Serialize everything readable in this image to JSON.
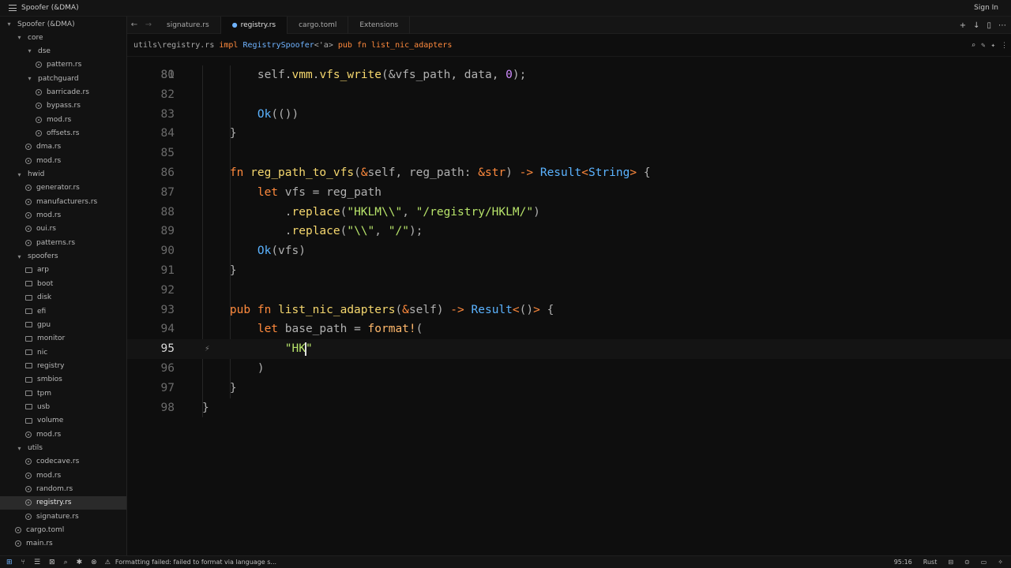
{
  "titlebar": {
    "app_title": "Spoofer (&DMA)",
    "signin": "Sign In"
  },
  "sidebar": {
    "root": "Spoofer (&DMA)",
    "items": [
      {
        "label": "core",
        "kind": "folder",
        "depth": 1,
        "expanded": true
      },
      {
        "label": "dse",
        "kind": "folder",
        "depth": 2,
        "expanded": true
      },
      {
        "label": "pattern.rs",
        "kind": "file",
        "depth": 3
      },
      {
        "label": "patchguard",
        "kind": "folder",
        "depth": 2,
        "expanded": true
      },
      {
        "label": "barricade.rs",
        "kind": "file",
        "depth": 3
      },
      {
        "label": "bypass.rs",
        "kind": "file",
        "depth": 3
      },
      {
        "label": "mod.rs",
        "kind": "file",
        "depth": 3
      },
      {
        "label": "offsets.rs",
        "kind": "file",
        "depth": 3
      },
      {
        "label": "dma.rs",
        "kind": "file",
        "depth": 2
      },
      {
        "label": "mod.rs",
        "kind": "file",
        "depth": 2
      },
      {
        "label": "hwid",
        "kind": "folder",
        "depth": 1,
        "expanded": true
      },
      {
        "label": "generator.rs",
        "kind": "file",
        "depth": 2
      },
      {
        "label": "manufacturers.rs",
        "kind": "file",
        "depth": 2
      },
      {
        "label": "mod.rs",
        "kind": "file",
        "depth": 2
      },
      {
        "label": "oui.rs",
        "kind": "file",
        "depth": 2
      },
      {
        "label": "patterns.rs",
        "kind": "file",
        "depth": 2
      },
      {
        "label": "spoofers",
        "kind": "folder",
        "depth": 1,
        "expanded": true
      },
      {
        "label": "arp",
        "kind": "folder",
        "depth": 2
      },
      {
        "label": "boot",
        "kind": "folder",
        "depth": 2
      },
      {
        "label": "disk",
        "kind": "folder",
        "depth": 2
      },
      {
        "label": "efi",
        "kind": "folder",
        "depth": 2
      },
      {
        "label": "gpu",
        "kind": "folder",
        "depth": 2
      },
      {
        "label": "monitor",
        "kind": "folder",
        "depth": 2
      },
      {
        "label": "nic",
        "kind": "folder",
        "depth": 2
      },
      {
        "label": "registry",
        "kind": "folder",
        "depth": 2
      },
      {
        "label": "smbios",
        "kind": "folder",
        "depth": 2
      },
      {
        "label": "tpm",
        "kind": "folder",
        "depth": 2
      },
      {
        "label": "usb",
        "kind": "folder",
        "depth": 2
      },
      {
        "label": "volume",
        "kind": "folder",
        "depth": 2
      },
      {
        "label": "mod.rs",
        "kind": "file",
        "depth": 2
      },
      {
        "label": "utils",
        "kind": "folder",
        "depth": 1,
        "expanded": true
      },
      {
        "label": "codecave.rs",
        "kind": "file",
        "depth": 2
      },
      {
        "label": "mod.rs",
        "kind": "file",
        "depth": 2
      },
      {
        "label": "random.rs",
        "kind": "file",
        "depth": 2
      },
      {
        "label": "registry.rs",
        "kind": "file",
        "depth": 2,
        "active": true
      },
      {
        "label": "signature.rs",
        "kind": "file",
        "depth": 2
      },
      {
        "label": "cargo.toml",
        "kind": "file",
        "depth": 1
      },
      {
        "label": "main.rs",
        "kind": "file",
        "depth": 1
      }
    ]
  },
  "tabs": [
    {
      "label": "signature.rs",
      "active": false
    },
    {
      "label": "registry.rs",
      "active": true,
      "modified": true
    },
    {
      "label": "cargo.toml",
      "active": false
    },
    {
      "label": "Extensions",
      "active": false
    }
  ],
  "breadcrumb": {
    "path": "utils\\registry.rs",
    "impl_kw": "impl",
    "impl_type": "RegistrySpoofer",
    "impl_generic": "<'a>",
    "fn_kw": "pub fn",
    "fn_name": "list_nic_adapters"
  },
  "editor": {
    "top_partial_line": "80",
    "current_line": 95,
    "lines": [
      {
        "n": "81",
        "tokens": [
          [
            "p",
            "        self."
          ],
          [
            "f",
            "vmm"
          ],
          [
            "p",
            "."
          ],
          [
            "f",
            "vfs_write"
          ],
          [
            "p",
            "(&vfs_path, data, "
          ],
          [
            "n",
            "0"
          ],
          [
            "p",
            ");"
          ]
        ]
      },
      {
        "n": "82",
        "tokens": []
      },
      {
        "n": "83",
        "tokens": [
          [
            "p",
            "        "
          ],
          [
            "t",
            "Ok"
          ],
          [
            "p",
            "(())"
          ]
        ]
      },
      {
        "n": "84",
        "tokens": [
          [
            "p",
            "    }"
          ]
        ]
      },
      {
        "n": "85",
        "tokens": []
      },
      {
        "n": "86",
        "tokens": [
          [
            "p",
            "    "
          ],
          [
            "k",
            "fn "
          ],
          [
            "f",
            "reg_path_to_vfs"
          ],
          [
            "p",
            "("
          ],
          [
            "k",
            "&"
          ],
          [
            "p",
            "self, reg_path: "
          ],
          [
            "k",
            "&"
          ],
          [
            "k",
            "str"
          ],
          [
            "p",
            ") "
          ],
          [
            "k",
            "->"
          ],
          [
            "p",
            " "
          ],
          [
            "t",
            "Result"
          ],
          [
            "k",
            "<"
          ],
          [
            "t",
            "String"
          ],
          [
            "k",
            "> "
          ],
          [
            "p",
            "{"
          ]
        ]
      },
      {
        "n": "87",
        "tokens": [
          [
            "p",
            "        "
          ],
          [
            "k",
            "let "
          ],
          [
            "p",
            "vfs = reg_path"
          ]
        ]
      },
      {
        "n": "88",
        "tokens": [
          [
            "p",
            "            ."
          ],
          [
            "f",
            "replace"
          ],
          [
            "p",
            "("
          ],
          [
            "s",
            "\"HKLM\\\\\""
          ],
          [
            "p",
            ", "
          ],
          [
            "s",
            "\"/registry/HKLM/\""
          ],
          [
            "p",
            ")"
          ]
        ]
      },
      {
        "n": "89",
        "tokens": [
          [
            "p",
            "            ."
          ],
          [
            "f",
            "replace"
          ],
          [
            "p",
            "("
          ],
          [
            "s",
            "\"\\\\\""
          ],
          [
            "p",
            ", "
          ],
          [
            "s",
            "\"/\""
          ],
          [
            "p",
            ");"
          ]
        ]
      },
      {
        "n": "90",
        "tokens": [
          [
            "p",
            "        "
          ],
          [
            "t",
            "Ok"
          ],
          [
            "p",
            "(vfs)"
          ]
        ]
      },
      {
        "n": "91",
        "tokens": [
          [
            "p",
            "    }"
          ]
        ]
      },
      {
        "n": "92",
        "tokens": []
      },
      {
        "n": "93",
        "tokens": [
          [
            "p",
            "    "
          ],
          [
            "k",
            "pub fn "
          ],
          [
            "f",
            "list_nic_adapters"
          ],
          [
            "p",
            "("
          ],
          [
            "k",
            "&"
          ],
          [
            "p",
            "self) "
          ],
          [
            "k",
            "->"
          ],
          [
            "p",
            " "
          ],
          [
            "t",
            "Result"
          ],
          [
            "k",
            "<"
          ],
          [
            "p",
            "()"
          ],
          [
            "k",
            "> "
          ],
          [
            "p",
            "{"
          ]
        ]
      },
      {
        "n": "94",
        "tokens": [
          [
            "p",
            "        "
          ],
          [
            "k",
            "let "
          ],
          [
            "p",
            "base_path = "
          ],
          [
            "m",
            "format!"
          ],
          [
            "p",
            "("
          ]
        ]
      },
      {
        "n": "95",
        "tokens": [
          [
            "p",
            "            "
          ],
          [
            "s",
            "\"HK"
          ],
          [
            "cursor",
            ""
          ],
          [
            "s",
            "\""
          ]
        ]
      },
      {
        "n": "96",
        "tokens": [
          [
            "p",
            "        )"
          ]
        ]
      },
      {
        "n": "97",
        "tokens": [
          [
            "p",
            "    }"
          ]
        ]
      },
      {
        "n": "98",
        "tokens": [
          [
            "p",
            "}"
          ]
        ]
      }
    ]
  },
  "statusbar": {
    "message": "Formatting failed: failed to format via language s...",
    "position": "95:16",
    "language": "Rust"
  },
  "colors": {
    "keyword": "#ff8a3d",
    "function": "#f5d76e",
    "type": "#5bb3ff",
    "string": "#b7e36a",
    "number": "#d08cff"
  }
}
